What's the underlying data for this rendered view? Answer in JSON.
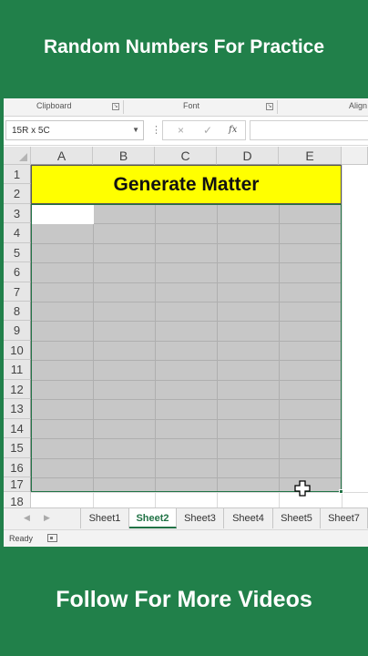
{
  "banner": {
    "top_text": "Random Numbers For Practice",
    "bottom_text": "Follow For More Videos",
    "color": "#21804a"
  },
  "ribbon": {
    "groups": [
      "Clipboard",
      "Font",
      "Align"
    ]
  },
  "formula_bar": {
    "name_box": "15R x 5C",
    "cancel_icon": "×",
    "enter_icon": "✓",
    "fx_label": "fx",
    "formula": ""
  },
  "sheet": {
    "columns": [
      "A",
      "B",
      "C",
      "D",
      "E"
    ],
    "rows": [
      "1",
      "2",
      "3",
      "4",
      "5",
      "6",
      "7",
      "8",
      "9",
      "10",
      "11",
      "12",
      "13",
      "14",
      "15",
      "16",
      "17",
      "18"
    ],
    "title_cell": "Generate Matter",
    "title_bg": "#ffff00",
    "selection_range_rows": "3-17",
    "selection_range_cols": "A-E"
  },
  "tabs": {
    "items": [
      "Sheet1",
      "Sheet2",
      "Sheet3",
      "Sheet4",
      "Sheet5",
      "Sheet7"
    ],
    "active": "Sheet2"
  },
  "status": {
    "text": "Ready"
  },
  "accent": "#217346"
}
